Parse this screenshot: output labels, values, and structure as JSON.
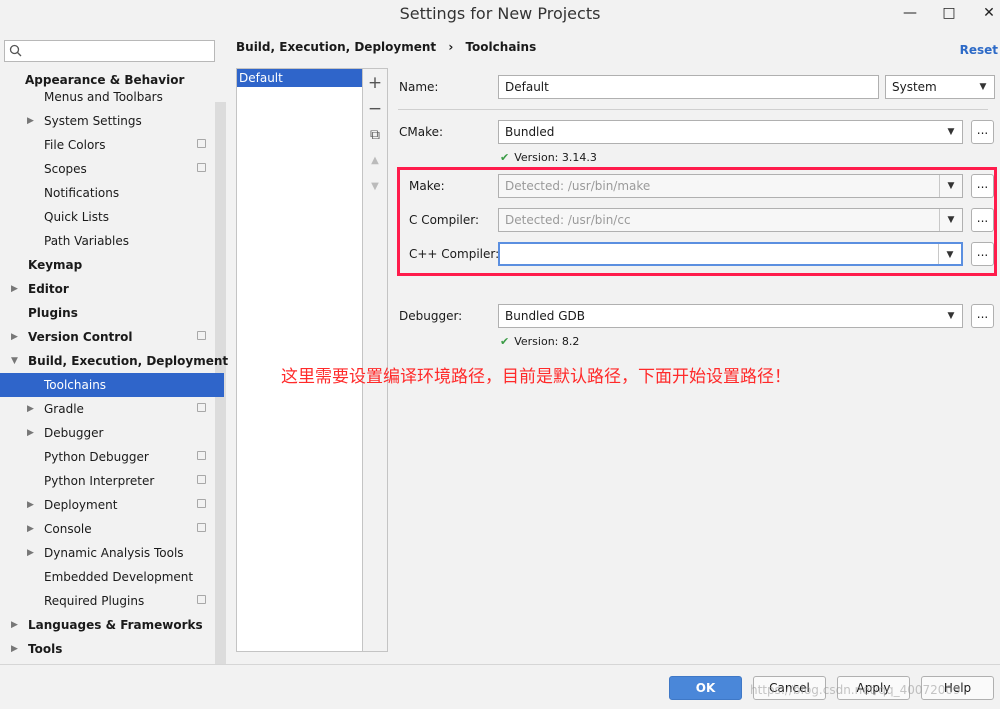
{
  "window": {
    "title": "Settings for New Projects",
    "minimize": "—",
    "maximize": "□",
    "close": "✕"
  },
  "sidebar": {
    "search_placeholder": "",
    "items": [
      {
        "label": "Appearance & Behavior",
        "bold": true
      },
      {
        "label": "Menus and Toolbars"
      },
      {
        "label": "System Settings"
      },
      {
        "label": "File Colors"
      },
      {
        "label": "Scopes"
      },
      {
        "label": "Notifications"
      },
      {
        "label": "Quick Lists"
      },
      {
        "label": "Path Variables"
      },
      {
        "label": "Keymap",
        "bold": true
      },
      {
        "label": "Editor",
        "bold": true
      },
      {
        "label": "Plugins",
        "bold": true
      },
      {
        "label": "Version Control",
        "bold": true
      },
      {
        "label": "Build, Execution, Deployment",
        "bold": true
      },
      {
        "label": "Toolchains",
        "selected": true
      },
      {
        "label": "Gradle"
      },
      {
        "label": "Debugger"
      },
      {
        "label": "Python Debugger"
      },
      {
        "label": "Python Interpreter"
      },
      {
        "label": "Deployment"
      },
      {
        "label": "Console"
      },
      {
        "label": "Dynamic Analysis Tools"
      },
      {
        "label": "Embedded Development"
      },
      {
        "label": "Required Plugins"
      },
      {
        "label": "Languages & Frameworks",
        "bold": true
      },
      {
        "label": "Tools",
        "bold": true
      }
    ]
  },
  "breadcrumb": {
    "parent": "Build, Execution, Deployment",
    "separator": "›",
    "current": "Toolchains"
  },
  "reset_label": "Reset",
  "toolchains": {
    "items": [
      "Default"
    ],
    "add": "+",
    "remove": "−",
    "copy": "⧉",
    "up": "▲",
    "down": "▼"
  },
  "form": {
    "name_label": "Name:",
    "name_value": "Default",
    "env_value": "System",
    "cmake_label": "CMake:",
    "cmake_value": "Bundled",
    "cmake_version": "Version: 3.14.3",
    "make_label": "Make:",
    "make_placeholder": "Detected: /usr/bin/make",
    "cc_label": "C Compiler:",
    "cc_placeholder": "Detected: /usr/bin/cc",
    "cxx_label": "C++ Compiler:",
    "cxx_value": "",
    "debugger_label": "Debugger:",
    "debugger_value": "Bundled GDB",
    "debugger_version": "Version: 8.2",
    "browse": "...",
    "check": "✔"
  },
  "annotation": "这里需要设置编译环境路径，目前是默认路径，下面开始设置路径！",
  "footer": {
    "ok": "OK",
    "cancel": "Cancel",
    "apply": "Apply",
    "help": "Help",
    "watermark": "https://blog.csdn.net/qq_40072009"
  },
  "colors": {
    "selection": "#2f65ca",
    "highlight_box": "#ff1c4c",
    "annotation_text": "#ff2a2a",
    "link": "#2d6ac7",
    "check": "#3a9b45"
  }
}
